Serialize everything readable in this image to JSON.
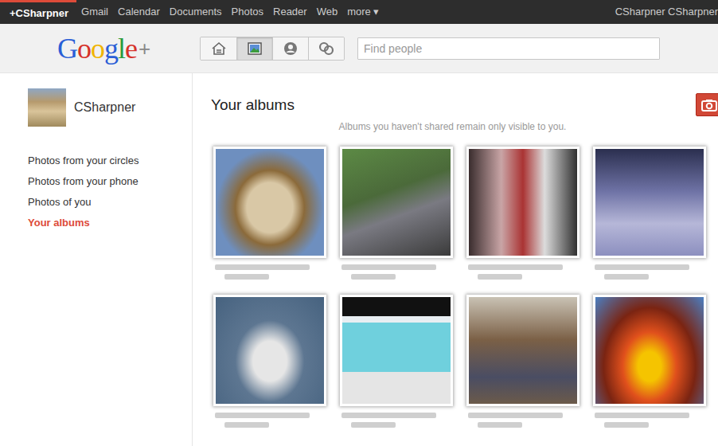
{
  "topbar": {
    "user": "+CSharpner",
    "links": [
      "Gmail",
      "Calendar",
      "Documents",
      "Photos",
      "Reader",
      "Web"
    ],
    "more": "more",
    "more_arrow": "▾",
    "account": "CSharpner CSharpner"
  },
  "logo": {
    "text": "Google",
    "plus": "+"
  },
  "nav_buttons": [
    {
      "kind": "stream",
      "selected": false
    },
    {
      "kind": "photos",
      "selected": true
    },
    {
      "kind": "profile",
      "selected": false
    },
    {
      "kind": "circles",
      "selected": false
    }
  ],
  "search": {
    "placeholder": "Find people"
  },
  "profile": {
    "name": "CSharpner"
  },
  "sidebar": {
    "items": [
      {
        "label": "Photos from your circles",
        "selected": false
      },
      {
        "label": "Photos from your phone",
        "selected": false
      },
      {
        "label": "Photos of you",
        "selected": false
      },
      {
        "label": "Your albums",
        "selected": true
      }
    ]
  },
  "page": {
    "title": "Your albums",
    "note": "Albums you haven't shared remain only visible to you."
  },
  "albums": [
    {},
    {},
    {},
    {},
    {},
    {},
    {},
    {}
  ]
}
